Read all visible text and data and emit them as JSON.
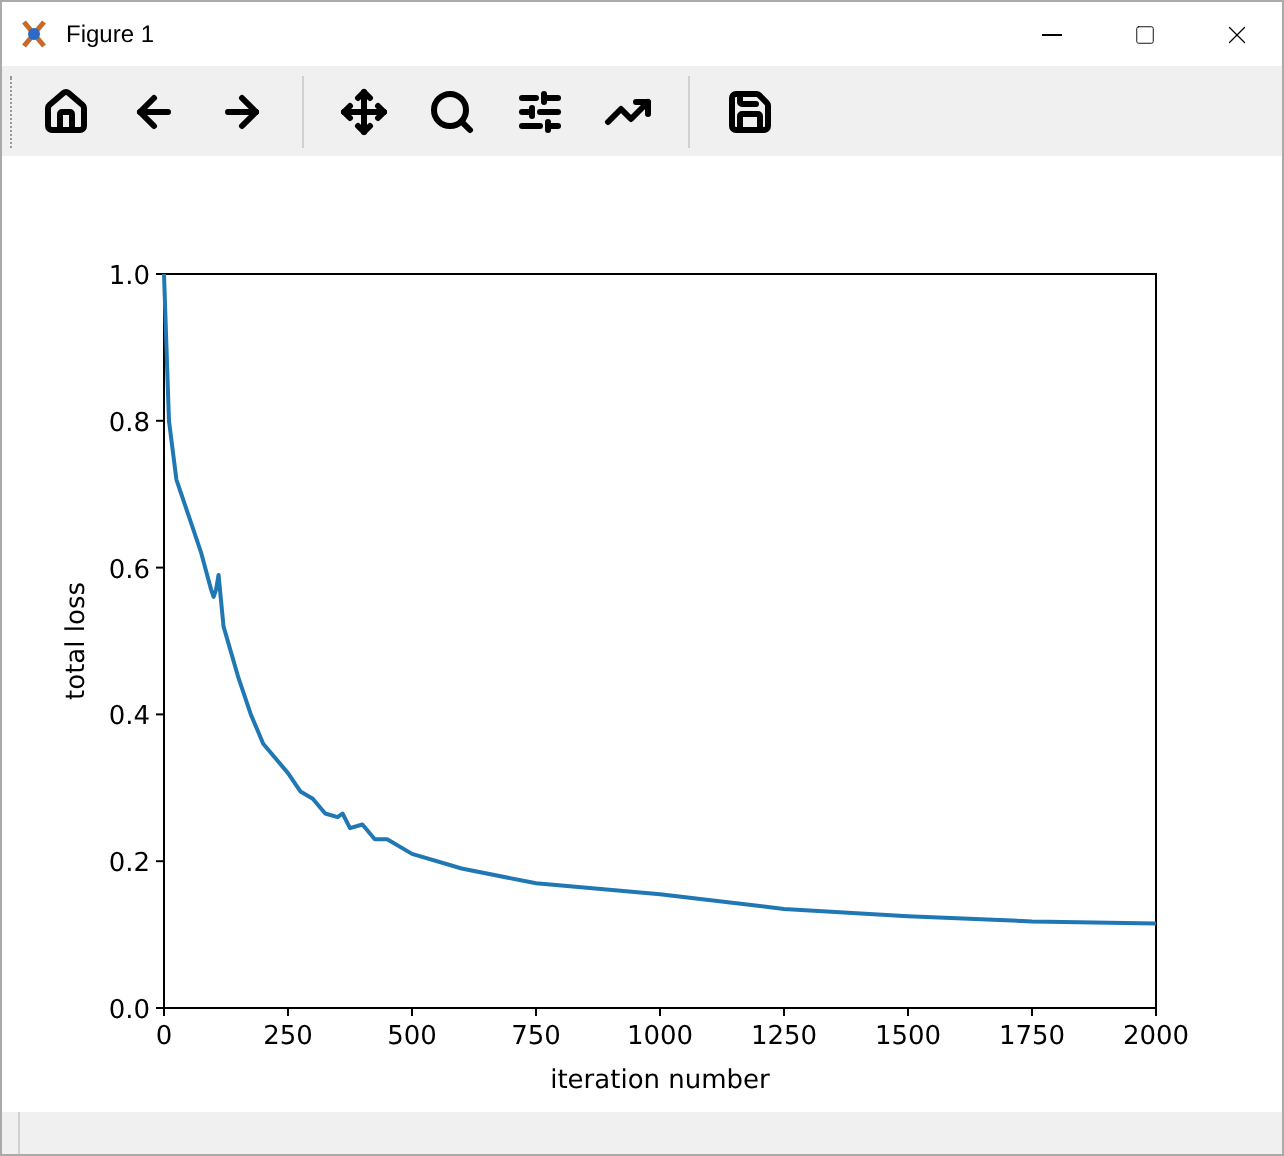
{
  "window": {
    "title": "Figure 1"
  },
  "figure": {
    "chart_data": {
      "type": "line",
      "xlabel": "iteration number",
      "ylabel": "total loss",
      "xlim": [
        0,
        2000
      ],
      "ylim": [
        0,
        1
      ],
      "xticks": [
        0,
        250,
        500,
        750,
        1000,
        1250,
        1500,
        1750,
        2000
      ],
      "yticks": [
        {
          "value": 0,
          "label": "0.0"
        },
        {
          "value": 0.2,
          "label": "0.2"
        },
        {
          "value": 0.4,
          "label": "0.4"
        },
        {
          "value": 0.6,
          "label": "0.6"
        },
        {
          "value": 0.8,
          "label": "0.8"
        },
        {
          "value": 1,
          "label": "1.0"
        }
      ],
      "x": [
        0,
        5,
        10,
        25,
        50,
        75,
        95,
        100,
        105,
        110,
        120,
        150,
        175,
        200,
        250,
        275,
        300,
        325,
        350,
        360,
        375,
        400,
        425,
        450,
        500,
        600,
        750,
        1000,
        1250,
        1500,
        1750,
        2000
      ],
      "series": [
        {
          "color": "#1f77b4",
          "values": [
            1.0,
            0.9,
            0.8,
            0.72,
            0.67,
            0.62,
            0.57,
            0.56,
            0.57,
            0.59,
            0.52,
            0.45,
            0.4,
            0.36,
            0.32,
            0.295,
            0.285,
            0.265,
            0.26,
            0.265,
            0.245,
            0.25,
            0.23,
            0.23,
            0.21,
            0.19,
            0.17,
            0.155,
            0.135,
            0.125,
            0.118,
            0.115
          ]
        }
      ]
    }
  }
}
